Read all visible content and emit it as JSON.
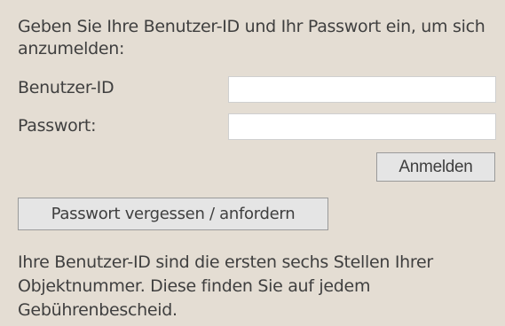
{
  "login": {
    "intro_text": "Geben Sie Ihre Benutzer-ID und Ihr Passwort ein, um sich anzumelden:",
    "user_id_label": "Benutzer-ID",
    "user_id_value": "",
    "password_label": "Passwort:",
    "password_value": "",
    "login_button": "Anmelden",
    "forgot_button": "Passwort vergessen / anfordern",
    "info_text": "Ihre Benutzer-ID sind die ersten sechs Stellen Ihrer Objektnummer. Diese finden Sie auf jedem Gebührenbescheid."
  },
  "colors": {
    "background": "#e4ddd3",
    "text": "#3f3f3f",
    "field_background": "#ffffff",
    "button_background": "#e5e5e5",
    "button_border": "#9a9a9a"
  }
}
